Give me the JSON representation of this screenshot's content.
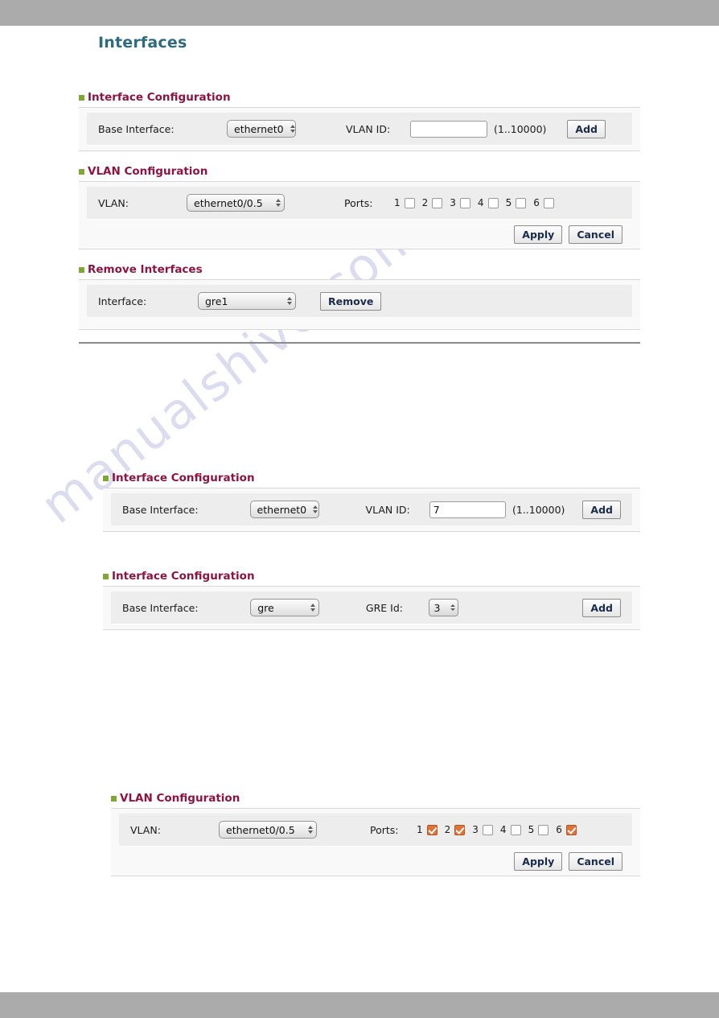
{
  "page": {
    "title": "Interfaces",
    "title_color": "#2e6b80",
    "section_heading_color": "#8d1440",
    "bullet_color": "#7fa832",
    "checked_checkbox_color": "#e0733a",
    "chrome_bar_color": "#ababab",
    "watermark_text": "manualshive.com"
  },
  "sections": {
    "interface_config_1": {
      "heading": "Interface Configuration",
      "base_interface_label": "Base Interface:",
      "base_interface_value": "ethernet0",
      "vlan_id_label": "VLAN ID:",
      "vlan_id_value": "",
      "vlan_id_placeholder": "",
      "range_hint": "(1..10000)",
      "add_label": "Add"
    },
    "vlan_config_1": {
      "heading": "VLAN Configuration",
      "vlan_label": "VLAN:",
      "vlan_value": "ethernet0/0.5",
      "ports_label": "Ports:",
      "ports": [
        {
          "number": "1",
          "checked": false
        },
        {
          "number": "2",
          "checked": false
        },
        {
          "number": "3",
          "checked": false
        },
        {
          "number": "4",
          "checked": false
        },
        {
          "number": "5",
          "checked": false
        },
        {
          "number": "6",
          "checked": false
        }
      ],
      "apply_label": "Apply",
      "cancel_label": "Cancel"
    },
    "remove_interfaces": {
      "heading": "Remove Interfaces",
      "interface_label": "Interface:",
      "interface_value": "gre1",
      "remove_label": "Remove"
    },
    "interface_config_2": {
      "heading": "Interface Configuration",
      "base_interface_label": "Base Interface:",
      "base_interface_value": "ethernet0",
      "vlan_id_label": "VLAN ID:",
      "vlan_id_value": "7",
      "range_hint": "(1..10000)",
      "add_label": "Add"
    },
    "interface_config_3": {
      "heading": "Interface Configuration",
      "base_interface_label": "Base Interface:",
      "base_interface_value": "gre",
      "gre_id_label": "GRE Id:",
      "gre_id_value": "3",
      "add_label": "Add"
    },
    "vlan_config_2": {
      "heading": "VLAN Configuration",
      "vlan_label": "VLAN:",
      "vlan_value": "ethernet0/0.5",
      "ports_label": "Ports:",
      "ports": [
        {
          "number": "1",
          "checked": true
        },
        {
          "number": "2",
          "checked": true
        },
        {
          "number": "3",
          "checked": false
        },
        {
          "number": "4",
          "checked": false
        },
        {
          "number": "5",
          "checked": false
        },
        {
          "number": "6",
          "checked": true
        }
      ],
      "apply_label": "Apply",
      "cancel_label": "Cancel"
    }
  }
}
